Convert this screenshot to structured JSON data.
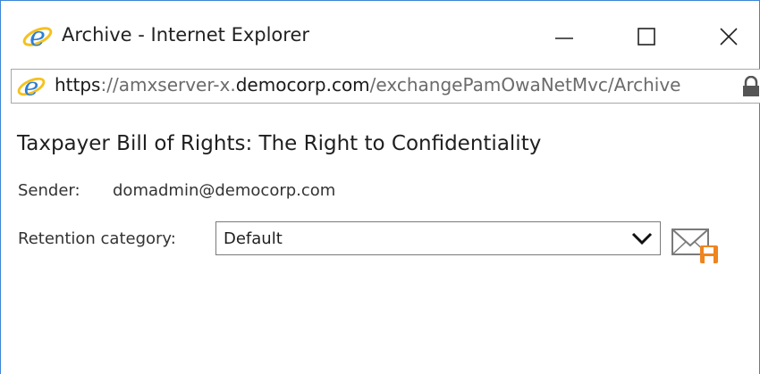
{
  "window": {
    "title": "Archive - Internet Explorer",
    "icons": {
      "app": "internet-explorer-icon",
      "minimize": "minimize-icon",
      "maximize": "maximize-icon",
      "close": "close-icon"
    }
  },
  "address": {
    "scheme": "https",
    "separator": "://amxserver-x.",
    "domain": "democorp.com",
    "path": "/exchangePamOwaNetMvc/Archive",
    "lock_icon": "lock-icon"
  },
  "message": {
    "subject": "Taxpayer Bill of Rights: The Right to Confidentiality",
    "sender_label": "Sender:",
    "sender_value": "domadmin@democorp.com",
    "retention_label": "Retention category:",
    "retention_value": "Default",
    "save_icon": "mail-save-icon"
  },
  "colors": {
    "window_border": "#3a86d6",
    "ie_blue": "#2b7fd3",
    "ie_ring": "#f5c11e",
    "save_orange": "#f0841d"
  }
}
